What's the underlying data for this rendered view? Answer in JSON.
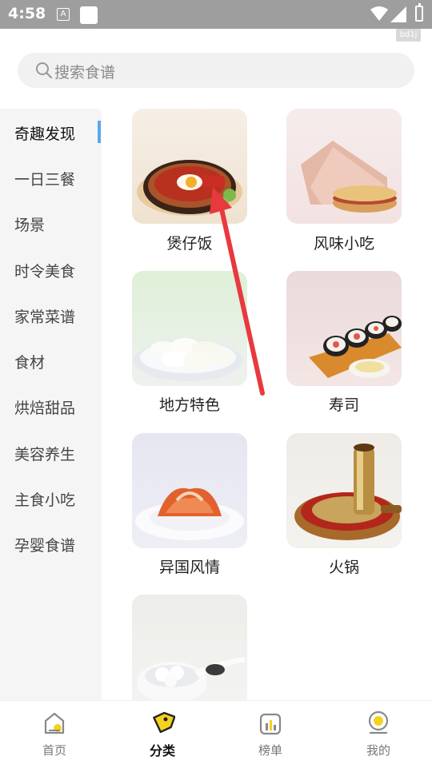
{
  "status_bar": {
    "time": "4:58",
    "notification_icon_letter": "A"
  },
  "watermark": "bd1j",
  "search": {
    "placeholder": "搜索食谱"
  },
  "sidebar": {
    "items": [
      {
        "label": "奇趣发现",
        "active": true
      },
      {
        "label": "一日三餐"
      },
      {
        "label": "场景"
      },
      {
        "label": "时令美食"
      },
      {
        "label": "家常菜谱"
      },
      {
        "label": "食材"
      },
      {
        "label": "烘焙甜品"
      },
      {
        "label": "美容养生"
      },
      {
        "label": "主食小吃"
      },
      {
        "label": "孕婴食谱"
      }
    ]
  },
  "categories": [
    {
      "label": "煲仔饭",
      "image": "claypot-rice-image"
    },
    {
      "label": "风味小吃",
      "image": "flatbread-snack-image"
    },
    {
      "label": "地方特色",
      "image": "dumplings-image"
    },
    {
      "label": "寿司",
      "image": "sushi-image"
    },
    {
      "label": "异国风情",
      "image": "kimchi-image"
    },
    {
      "label": "火锅",
      "image": "hotpot-image"
    },
    {
      "label": "",
      "image": "tangyuan-image"
    }
  ],
  "tabbar": {
    "items": [
      {
        "label": "首页",
        "icon": "home-icon"
      },
      {
        "label": "分类",
        "icon": "category-tag-icon",
        "active": true
      },
      {
        "label": "榜单",
        "icon": "chart-icon"
      },
      {
        "label": "我的",
        "icon": "profile-icon"
      }
    ]
  },
  "colors": {
    "accent": "#f5d21f",
    "active_indicator": "#58a9f0",
    "annotation_arrow": "#e8393f"
  }
}
